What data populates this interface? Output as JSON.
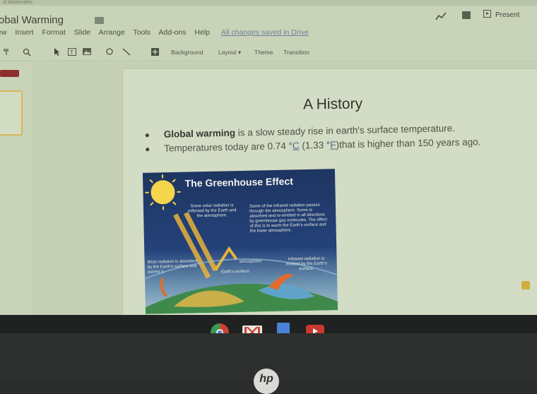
{
  "browser": {
    "bookmarks_bar": "ot bookmarks"
  },
  "app": {
    "doc_title": "obal Warming",
    "menu": [
      "ew",
      "Insert",
      "Format",
      "Slide",
      "Arrange",
      "Tools",
      "Add-ons",
      "Help"
    ],
    "save_status": "All changes saved in Drive",
    "present_label": "Present"
  },
  "toolbar": {
    "background_label": "Background",
    "layout_label": "Layout",
    "theme_label": "Theme",
    "transition_label": "Transition"
  },
  "slide": {
    "title": "A History",
    "bullet1_bold": "Global warming",
    "bullet1_rest": " is a slow steady rise in earth's surface temperature.",
    "bullet2_pre": "Temperatures today are 0.74 °",
    "bullet2_c": "C",
    "bullet2_mid": " (1.33 °",
    "bullet2_f": "F",
    "bullet2_post": ")that is higher than 150 years ago."
  },
  "image": {
    "title": "The Greenhouse Effect",
    "caption_reflected": "Some solar radiation is reflected by the Earth and the atmosphere.",
    "caption_infrared": "Some of the infrared radiation passes through the atmosphere. Some is absorbed and re-emitted in all directions by greenhouse gas molecules. The effect of this is to warm the Earth's surface and the lower atmosphere.",
    "caption_absorbed": "Most radiation is absorbed by the Earth's surface and warms it.",
    "caption_emitted": "Infrared radiation is emitted by the Earth's surface.",
    "label_surface": "Earth's surface",
    "label_atmosphere": "atmosphere"
  },
  "shelf": {
    "apps": [
      "chrome-icon",
      "gmail-icon",
      "docs-icon",
      "youtube-icon"
    ]
  },
  "colors": {
    "screen_bg": "#c9d3b8",
    "slide_bg": "#d3dcc4",
    "link": "#6e7fa0"
  }
}
